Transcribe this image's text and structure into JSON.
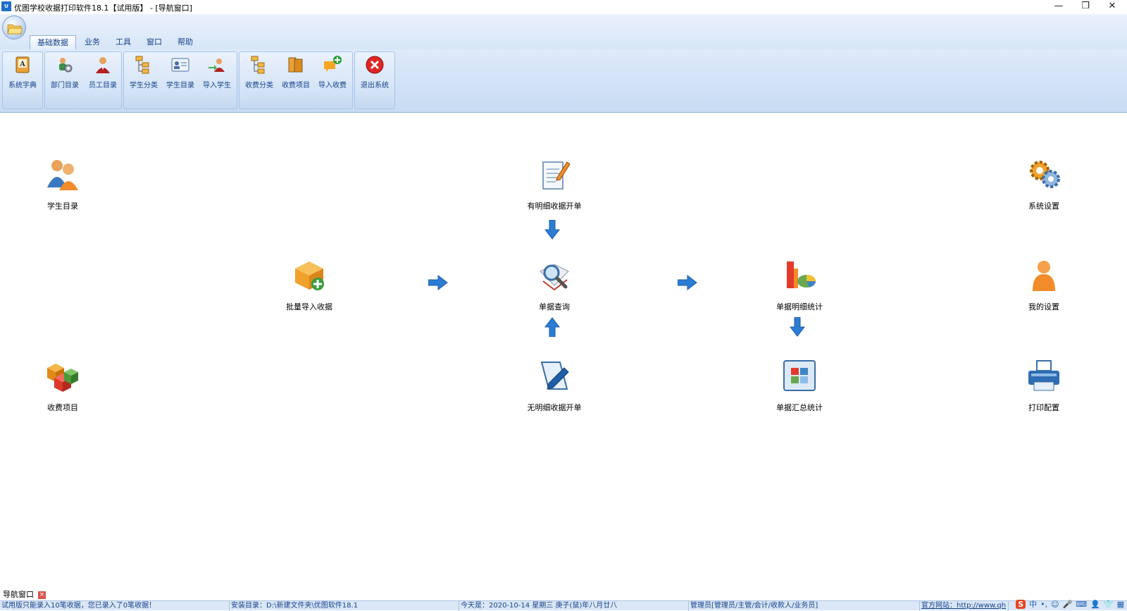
{
  "window": {
    "logo_text": "U",
    "title": "优图学校收据打印软件18.1【试用版】 - [导航窗口]",
    "minimize": "—",
    "restore": "❐",
    "close": "✕"
  },
  "ribbon": {
    "tabs": [
      {
        "label": "基础数据",
        "active": true
      },
      {
        "label": "业务",
        "active": false
      },
      {
        "label": "工具",
        "active": false
      },
      {
        "label": "窗口",
        "active": false
      },
      {
        "label": "帮助",
        "active": false
      }
    ],
    "buttons": {
      "sys_dict": "系统字典",
      "dept_list": "部门目录",
      "staff_list": "员工目录",
      "student_category": "学生分类",
      "student_list": "学生目录",
      "import_student": "导入学生",
      "fee_category": "收费分类",
      "fee_item": "收费项目",
      "import_fee": "导入收费",
      "exit_system": "退出系统"
    }
  },
  "nav": {
    "student_list": "学生目录",
    "fee_item": "收费项目",
    "batch_import": "批量导入收据",
    "detailed_receipt": "有明细收据开单",
    "receipt_query": "单据查询",
    "no_detail_receipt": "无明细收据开单",
    "receipt_detail_stats": "单据明细统计",
    "receipt_summary_stats": "单据汇总统计",
    "system_settings": "系统设置",
    "my_settings": "我的设置",
    "print_config": "打印配置"
  },
  "doc_tab": {
    "label": "导航窗口",
    "close": "×"
  },
  "statusbar": {
    "trial": "试用版只能录入10笔收据，您已录入了0笔收据！",
    "install_dir": "安装目录：D:\\新建文件夹\\优图软件18.1",
    "today": "今天是：2020-10-14 星期三 庚子(鼠)年八月廿八",
    "user": "管理员[管理员/主管/会计/收款人/业务员]",
    "website": "官方网站：http://www.qh"
  },
  "tray": {
    "ime_logo": "S",
    "lang": "中",
    "punct": "•,",
    "emoji": "☺",
    "mic": "🎤",
    "keyboard": "⌨",
    "user": "👤",
    "shirt": "👕",
    "grid": "▦"
  },
  "colors": {
    "ribbon_text": "#15428b",
    "accent": "#1f6fc8",
    "exit_red": "#e02424"
  }
}
